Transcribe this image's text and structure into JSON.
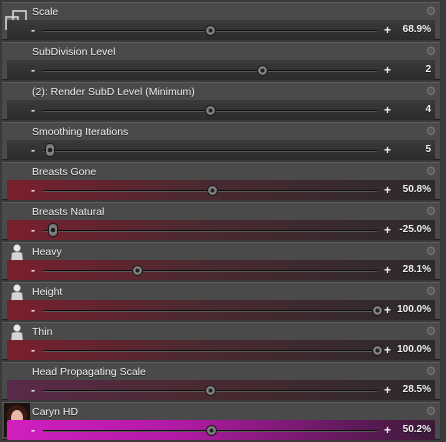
{
  "sliders": [
    {
      "label": "Scale",
      "value": "68.9%",
      "position": 0.5,
      "style": "gray",
      "icon": "scale-icon",
      "knob": "round"
    },
    {
      "label": "SubDivision Level",
      "value": "2",
      "position": 0.655,
      "style": "gray",
      "icon": null,
      "knob": "round"
    },
    {
      "label": "(2): Render SubD Level (Minimum)",
      "value": "4",
      "position": 0.5,
      "style": "gray",
      "icon": null,
      "knob": "round"
    },
    {
      "label": "Smoothing Iterations",
      "value": "5",
      "position": 0.02,
      "style": "gray",
      "icon": null,
      "knob": "cap"
    },
    {
      "label": "Breasts Gone",
      "value": "50.8%",
      "position": 0.505,
      "style": "red",
      "icon": null,
      "knob": "round"
    },
    {
      "label": "Breasts Natural",
      "value": "-25.0%",
      "position": 0.03,
      "style": "red",
      "icon": null,
      "knob": "cap"
    },
    {
      "label": "Heavy",
      "value": "28.1%",
      "position": 0.281,
      "style": "red",
      "icon": "body-heavy-icon",
      "knob": "round"
    },
    {
      "label": "Height",
      "value": "100.0%",
      "position": 1.0,
      "style": "red",
      "icon": "body-height-icon",
      "knob": "round"
    },
    {
      "label": "Thin",
      "value": "100.0%",
      "position": 1.0,
      "style": "red",
      "icon": "body-thin-icon",
      "knob": "round"
    },
    {
      "label": "Head Propagating Scale",
      "value": "28.5%",
      "position": 0.5,
      "style": "purple",
      "icon": null,
      "knob": "round"
    },
    {
      "label": "Caryn HD",
      "value": "50.2%",
      "position": 0.502,
      "style": "magenta",
      "icon": "character-portrait-icon",
      "knob": "round"
    }
  ],
  "controls": {
    "minus": "-",
    "plus": "+"
  },
  "colors": {
    "gray": "#262626",
    "red": "#7a1f2e",
    "purple": "#5a2a4a",
    "magenta": "#d11fbf"
  }
}
